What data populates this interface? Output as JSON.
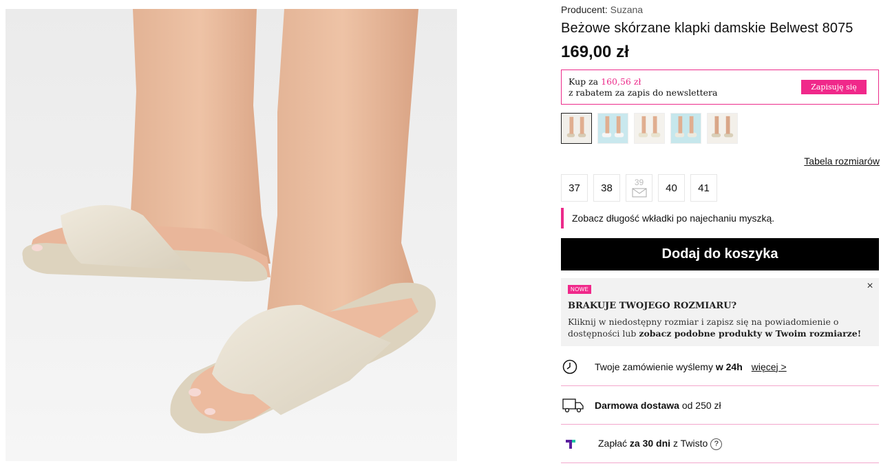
{
  "product": {
    "producer_label": "Producent:",
    "producer_value": "Suzana",
    "title": "Beżowe skórzane klapki damskie Belwest 8075",
    "price": "169,00 zł"
  },
  "newsletter": {
    "buy_for": "Kup za",
    "discount_price": "160,56 zł",
    "line2": "z rabatem za zapis do newslettera",
    "button": "Zapisuję się"
  },
  "thumbnails": [
    {
      "name": "thumb-1",
      "active": true
    },
    {
      "name": "thumb-2",
      "active": false
    },
    {
      "name": "thumb-3",
      "active": false
    },
    {
      "name": "thumb-4",
      "active": false
    },
    {
      "name": "thumb-5",
      "active": false
    }
  ],
  "size_table_link": "Tabela rozmiarów",
  "sizes": [
    {
      "label": "37",
      "available": true
    },
    {
      "label": "38",
      "available": true
    },
    {
      "label": "39",
      "available": false
    },
    {
      "label": "40",
      "available": true
    },
    {
      "label": "41",
      "available": true
    }
  ],
  "hint": "Zobacz długość wkładki po najechaniu myszką.",
  "add_to_cart": "Dodaj do koszyka",
  "missing_size": {
    "badge": "NOWE",
    "heading": "BRAKUJE TWOJEGO ROZMIARU?",
    "body_line1": "Kliknij w niedostępny rozmiar i zapisz się na powiadomienie o",
    "body_line2_start": "dostępności lub ",
    "body_line2_bold": "zobacz podobne produkty w Twoim rozmiarze!",
    "close": "×"
  },
  "features": {
    "shipping_time": {
      "pre": "Twoje zamówienie wyślemy ",
      "bold": "w 24h",
      "more": "więcej >",
      "icon": "clock-icon"
    },
    "free_delivery": {
      "bold": "Darmowa dostawa",
      "post": " od 250 zł",
      "icon": "truck-icon"
    },
    "twisto": {
      "pre": "Zapłać ",
      "bold": "za 30 dni",
      "post": " z Twisto",
      "help": "?",
      "icon": "twisto-logo"
    }
  },
  "colors": {
    "accent": "#ec2a8a",
    "button": "#000000",
    "twisto": "#5a1f9e"
  }
}
